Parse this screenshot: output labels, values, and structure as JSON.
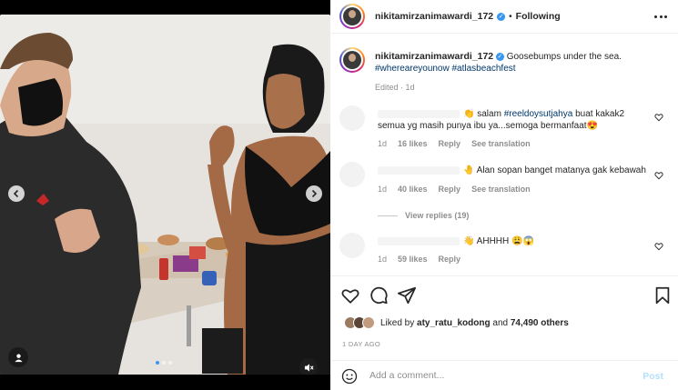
{
  "post": {
    "username": "nikitamirzanimawardi_172",
    "follow_status": "Following"
  },
  "caption": {
    "username": "nikitamirzanimawardi_172",
    "text": "Goosebumps under the sea.",
    "hashtags": "#whereareyounow #atlasbeachfest",
    "edited": "Edited · 1d"
  },
  "comments": [
    {
      "text_prefix": "👏 salam ",
      "mention": "#reeldoysutjahya",
      "text_suffix": " buat kakak2 semua yg masih punya ibu ya...semoga bermanfaat😍",
      "time": "1d",
      "likes": "16 likes",
      "reply": "Reply",
      "translate": "See translation"
    },
    {
      "text": "🤚 Alan sopan banget matanya gak kebawah",
      "time": "1d",
      "likes": "40 likes",
      "reply": "Reply",
      "translate": "See translation",
      "view_replies": "View replies (19)"
    },
    {
      "text": "👋 AHHHH 😩😱",
      "time": "1d",
      "likes": "59 likes",
      "reply": "Reply"
    }
  ],
  "likes": {
    "prefix": "Liked by",
    "user": "aty_ratu_kodong",
    "middle": "and",
    "count": "74,490 others"
  },
  "time_ago": "1 DAY AGO",
  "add_comment": {
    "placeholder": "Add a comment...",
    "post_label": "Post"
  },
  "colors": {
    "accent": "#3897f0",
    "hashtag": "#00376b",
    "muted": "#8e8e8e",
    "post_disabled": "#b2dffc"
  }
}
